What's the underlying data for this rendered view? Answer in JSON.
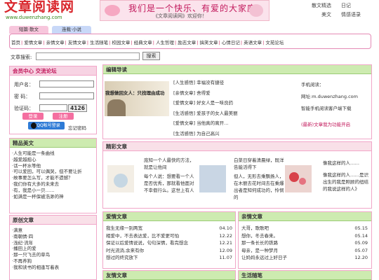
{
  "header": {
    "logo_text": "文章阅读网",
    "logo_url": "www.duwenzhang.com",
    "banner_slogan": "我们是一个快乐、有爱的大家庭",
    "banner_sub": "《文章阅读网》欢迎你！",
    "top_links": [
      "散文精选",
      "日记",
      "美文",
      "情感语录"
    ]
  },
  "tabs": [
    "短篇·散文",
    "连载·小说"
  ],
  "nav": {
    "row1": [
      "首页",
      "爱情文章",
      "亲情文章",
      "友情文章",
      "生活随笔",
      "校园文章",
      "经典文章",
      "人生哲理",
      "励志文章",
      "搞笑文章",
      "心情日记",
      "英语文章",
      "文苑论坛"
    ]
  },
  "search": {
    "label": "文章搜索:",
    "placeholder": "",
    "button": "搜索"
  },
  "member": {
    "title": "会员中心  交流论坛",
    "user_label": "用户名：",
    "pass_label": "密  码：",
    "code_label": "验证码：",
    "code_value": "4126",
    "login": "登录",
    "register": "注册",
    "qq": "用QQ帐号登录",
    "forget": "忘记密码"
  },
  "jp": {
    "title": "精品美文",
    "items": [
      "·人生可能是一条曲线",
      "·越爱越担心",
      "·话一杯水等他",
      "·可以爱回，可以偶哭，但不要让折",
      "·故事要怎么写，才能不遗憾？",
      "·我们你有大多的未来去",
      "·有，我是小一贝……",
      "·如满是一杯保被浩渺的神"
    ]
  },
  "yc": {
    "title": "原创文章",
    "items": [
      "·满意",
      "·南朝情·四",
      "·浅纪·流年",
      "·播田上的爱",
      "·那一只飞去的草鸟",
      "·不再养狗",
      "·我和读书的相逢写着表"
    ]
  },
  "editor": {
    "title": "编辑导读",
    "image_text": "我想做回女人：只找理由成功",
    "items": [
      "[人生感悟] 幸福没有捷径",
      "[亲情文章] 舍得爱",
      "[爱情文章] 好女人是一味良药",
      "[生活感悟] 爱孩子的女人最美丽",
      "[爱情文章] 当他真的离开…",
      "[生活感悟] 为自己高兴"
    ],
    "right": [
      "手机阅读：",
      "网址:m.duwenzhang.com",
      "智能手机阅读客户端下载",
      "(最新)文章我为功能开启"
    ]
  },
  "wonder": {
    "title": "精彩文章",
    "items": [
      {
        "text": "庞知一个人最快的方法，就是让他间",
        "text2": "每个人说：想要看一个人是否优秀，那就看他面对不幸假行么。这世上有人"
      },
      {
        "text": "白菜日穿着清晨绿，既洋告能活得下",
        "text2": "但人，无形去乘飘扬人，在木丽去花时间去在乘爆出者是知何成功的，怜悯的"
      },
      {
        "text": "像我这样的人……",
        "text2": "像我这样的人……是识出生的我是照顾的纽结的我说这样的人》"
      }
    ]
  },
  "aq": {
    "title": "爱情文章",
    "rows": [
      {
        "t": "我生无缘一别两宽",
        "d": "04.10"
      },
      {
        "t": "相爱中，不去表达爱，比不爱更可怕",
        "d": "12.22"
      },
      {
        "t": "保证以后爱情说说，句句深情，看完想念",
        "d": "12.21"
      },
      {
        "t": "时光流淌,余来有你",
        "d": "12.09"
      },
      {
        "t": "想过的终究放下",
        "d": "11.07"
      }
    ]
  },
  "qg": {
    "title": "亲情文章",
    "rows": [
      {
        "t": "大哥，歌歌吧",
        "d": "05.15"
      },
      {
        "t": "想你，冬去春来。",
        "d": "05.14"
      },
      {
        "t": "那一条长长的铁路",
        "d": "05.09"
      },
      {
        "t": "母亲，是一种梦月",
        "d": "05.07"
      },
      {
        "t": "让妈妈永远过上好日子",
        "d": "12.20"
      }
    ]
  },
  "yq": {
    "title": "友情文章"
  },
  "sh": {
    "title": "生活随笔"
  },
  "colors": {
    "pink_border": "#f1a6c8",
    "pink_header": "#f7d3e3",
    "green_header": "#cdebb0",
    "logo_red": "#d9262c"
  }
}
